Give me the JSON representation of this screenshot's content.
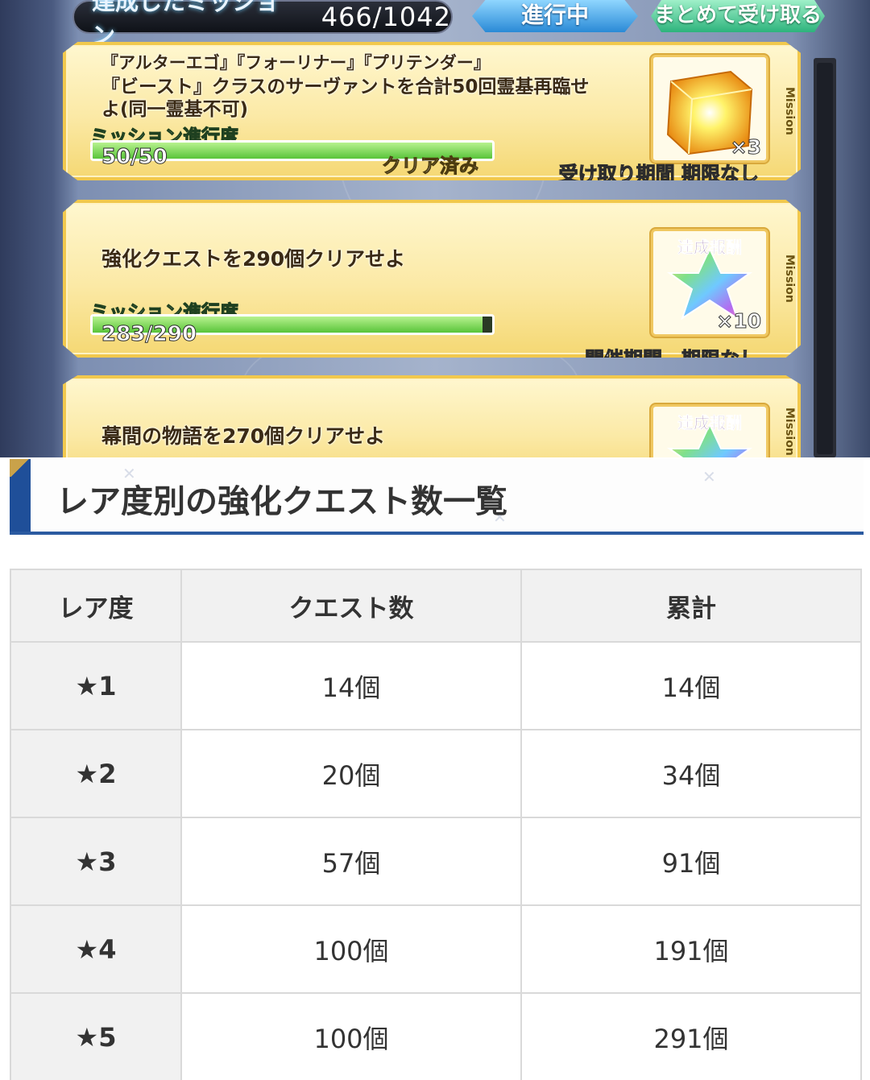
{
  "game": {
    "header": {
      "achieved_label": "達成したミッション",
      "achieved_count": "466/1042",
      "status_button": "進行中",
      "claim_all_button": "まとめて受け取る"
    },
    "missions": [
      {
        "text_line1": "『アルターエゴ』『フォーリナー』『プリテンダー』",
        "text_line2": "『ビースト』クラスのサーヴァントを合計50回霊基再臨せ",
        "text_line3": "よ(同一霊基不可)",
        "progress_label": "ミッション進行度",
        "progress_value": "50/50",
        "progress_fraction": 1.0,
        "cleared_label": "クリア済み",
        "reward_caption": "",
        "reward_icon": "golden-cube-icon",
        "reward_qty": "×3",
        "side_tag": "Mission",
        "period_text": "受け取り期間 期限なし"
      },
      {
        "text_line1": "強化クエストを290個クリアせよ",
        "progress_label": "ミッション進行度",
        "progress_value": "283/290",
        "progress_fraction": 0.976,
        "reward_caption": "達成報酬",
        "reward_icon": "rainbow-star-crystal-icon",
        "reward_qty": "×10",
        "side_tag": "Mission",
        "period_text": "開催期間　期限なし"
      },
      {
        "text_line1": "幕間の物語を270個クリアせよ",
        "reward_caption": "達成報酬",
        "reward_icon": "rainbow-star-crystal-icon",
        "side_tag": "Mission"
      }
    ]
  },
  "article": {
    "heading": "レア度別の強化クエスト数一覧",
    "table": {
      "headers": [
        "レア度",
        "クエスト数",
        "累計"
      ],
      "rows": [
        {
          "rarity": "★1",
          "count": "14個",
          "total": "14個"
        },
        {
          "rarity": "★2",
          "count": "20個",
          "total": "34個"
        },
        {
          "rarity": "★3",
          "count": "57個",
          "total": "91個"
        },
        {
          "rarity": "★4",
          "count": "100個",
          "total": "191個"
        },
        {
          "rarity": "★5",
          "count": "100個",
          "total": "291個"
        }
      ]
    }
  },
  "colors": {
    "accent_blue": "#2b5aa0",
    "card_gold": "#f1c84d",
    "progress_green": "#59c43a"
  }
}
